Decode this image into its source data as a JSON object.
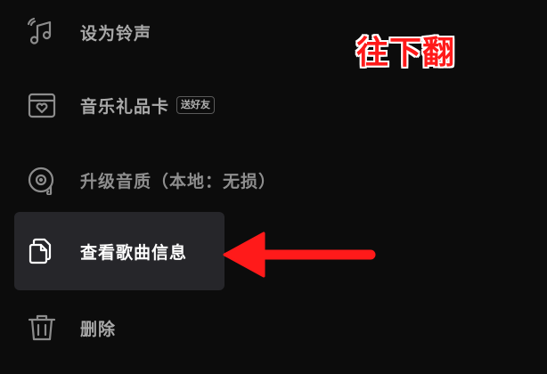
{
  "menu": {
    "items": [
      {
        "label": "设为铃声",
        "icon": "ringtone-icon"
      },
      {
        "label": "音乐礼品卡",
        "badge": "送好友",
        "icon": "gift-card-icon"
      },
      {
        "label": "升级音质（本地：无损）",
        "icon": "vinyl-disc-icon"
      },
      {
        "label": "查看歌曲信息",
        "icon": "document-copy-icon",
        "highlighted": true
      },
      {
        "label": "删除",
        "icon": "trash-icon"
      }
    ]
  },
  "annotation": {
    "scroll_hint": "往下翻",
    "arrow_color": "#ff1a1a"
  },
  "colors": {
    "background": "#0c0c0c",
    "highlight_bg": "#26262a",
    "label": "#a9a9a9",
    "label_active": "#ffffff"
  }
}
